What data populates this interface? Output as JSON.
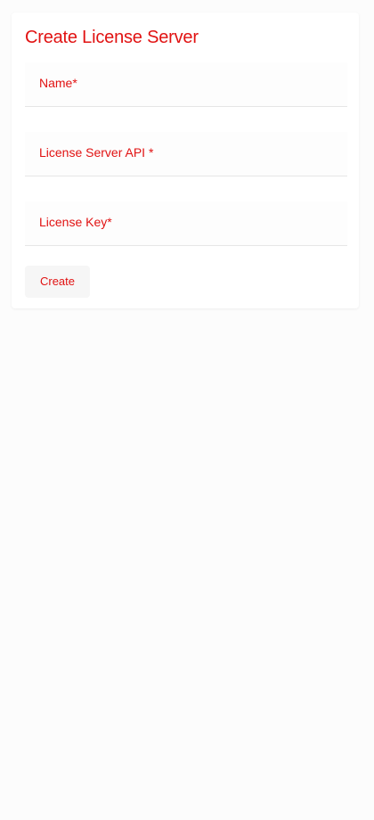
{
  "form": {
    "title": "Create License Server",
    "fields": [
      {
        "label": "Name*",
        "value": ""
      },
      {
        "label": "License Server API *",
        "value": ""
      },
      {
        "label": "License Key*",
        "value": ""
      }
    ],
    "submit_label": "Create"
  },
  "colors": {
    "text_accent": "#e11212",
    "page_background": "#fcfcfc",
    "card_background": "#ffffff",
    "button_background": "#f6f6f6",
    "field_underline": "#e6e6e6"
  }
}
